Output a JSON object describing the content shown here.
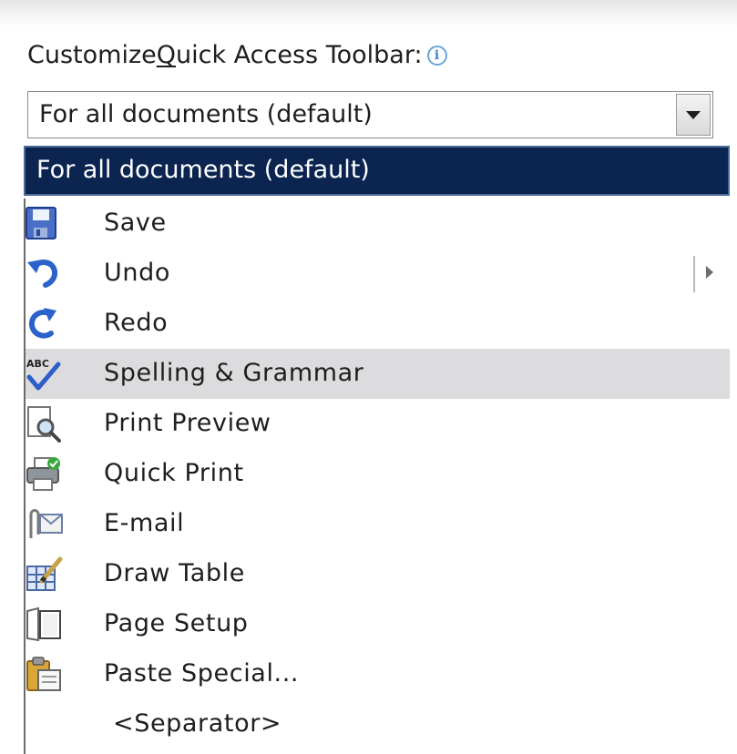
{
  "heading": {
    "before": "Customize ",
    "underlined": "Q",
    "after": "uick Access Toolbar:",
    "info_icon": "info-icon"
  },
  "combo": {
    "value": "For all documents (default)",
    "dropdown_icon": "chevron-down-icon"
  },
  "dropdown": {
    "selected": "For all documents (default)"
  },
  "commands": [
    {
      "label": "Save",
      "icon": "save-icon"
    },
    {
      "label": "Undo",
      "icon": "undo-icon",
      "has_submenu": true
    },
    {
      "label": "Redo",
      "icon": "redo-icon"
    },
    {
      "label": "Spelling & Grammar",
      "icon": "spelling-grammar-icon",
      "highlighted": true
    },
    {
      "label": "Print Preview",
      "icon": "print-preview-icon"
    },
    {
      "label": "Quick Print",
      "icon": "quick-print-icon"
    },
    {
      "label": "E-mail",
      "icon": "email-icon"
    },
    {
      "label": "Draw Table",
      "icon": "draw-table-icon"
    },
    {
      "label": "Page Setup",
      "icon": "page-setup-icon"
    },
    {
      "label": "Paste Special...",
      "icon": "paste-special-icon"
    },
    {
      "label": "<Separator>",
      "icon": ""
    }
  ],
  "colors": {
    "selection_bg": "#0b2450",
    "highlight_bg": "#dcdcdf"
  }
}
